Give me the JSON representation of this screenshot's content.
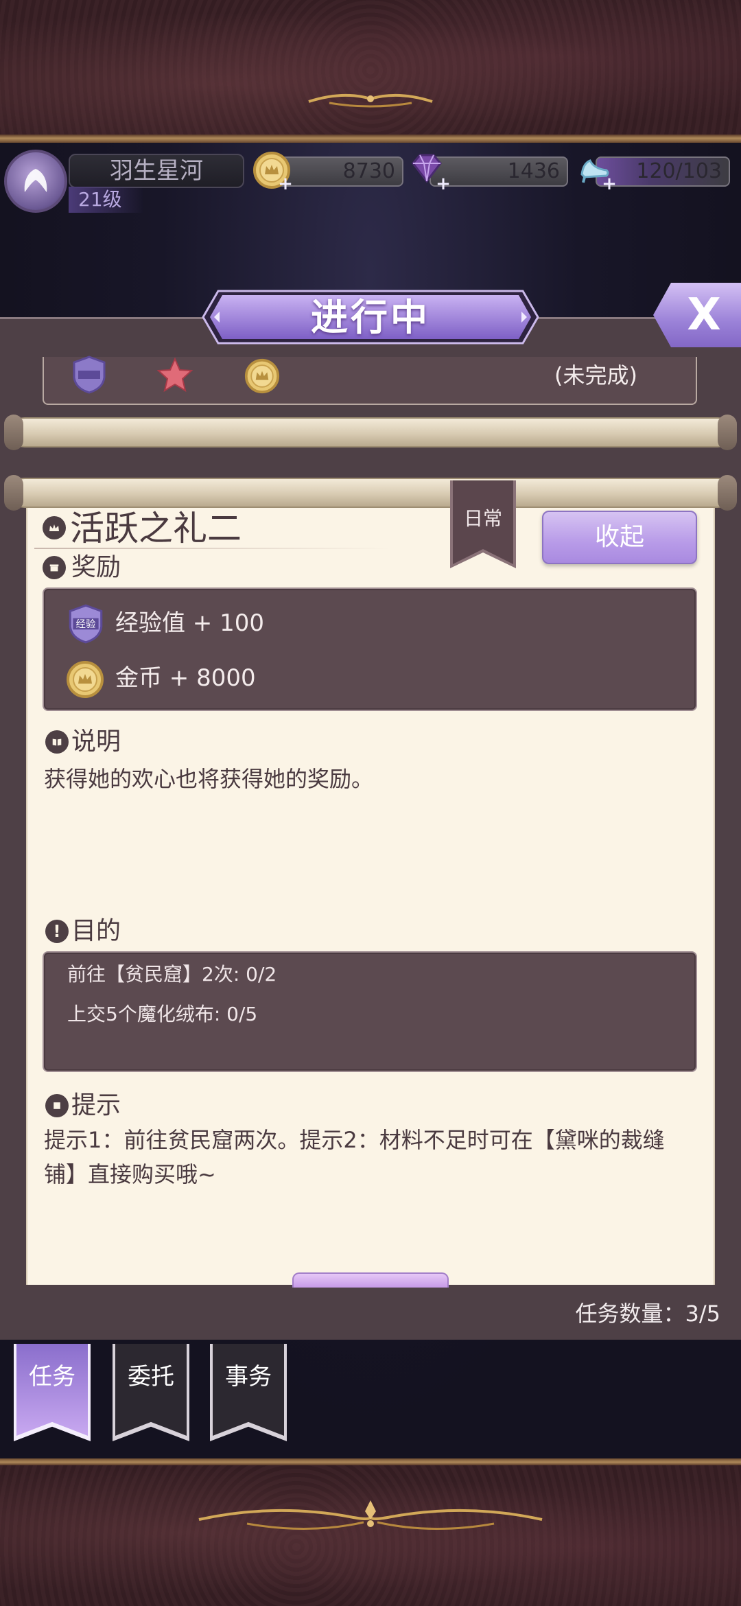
{
  "player": {
    "name": "羽生星河",
    "level": "21级"
  },
  "resources": {
    "gold": "8730",
    "gems": "1436",
    "stamina": "120/103"
  },
  "header": {
    "title": "进行中",
    "close_label": "X"
  },
  "previous_quest": {
    "status": "(未完成)",
    "reward_icons": [
      "exp-badge-icon",
      "star-icon",
      "gold-coin-icon"
    ]
  },
  "quest": {
    "title": "活跃之礼二",
    "tag": "日常",
    "collapse_label": "收起",
    "rewards_label": "奖励",
    "rewards": [
      {
        "icon": "exp-badge-icon",
        "badge_text": "经验",
        "text": "经验值 + 100"
      },
      {
        "icon": "gold-coin-icon",
        "text": "金币 + 8000"
      }
    ],
    "description_label": "说明",
    "description": "获得她的欢心也将获得她的奖励。",
    "objectives_label": "目的",
    "objectives": [
      "前往【贫民窟】2次: 0/2",
      "上交5个魔化绒布: 0/5"
    ],
    "hints_label": "提示",
    "hints": "提示1：前往贫民窟两次。提示2：材料不足时可在【黛咪的裁缝铺】直接购买哦~"
  },
  "task_count": "任务数量：3/5",
  "tabs": [
    {
      "label": "任务",
      "active": true
    },
    {
      "label": "委托",
      "active": false
    },
    {
      "label": "事务",
      "active": false
    }
  ],
  "colors": {
    "accent_purple": "#b89be8",
    "panel_dark": "#5c4a50",
    "paper": "#fbf4e6"
  }
}
